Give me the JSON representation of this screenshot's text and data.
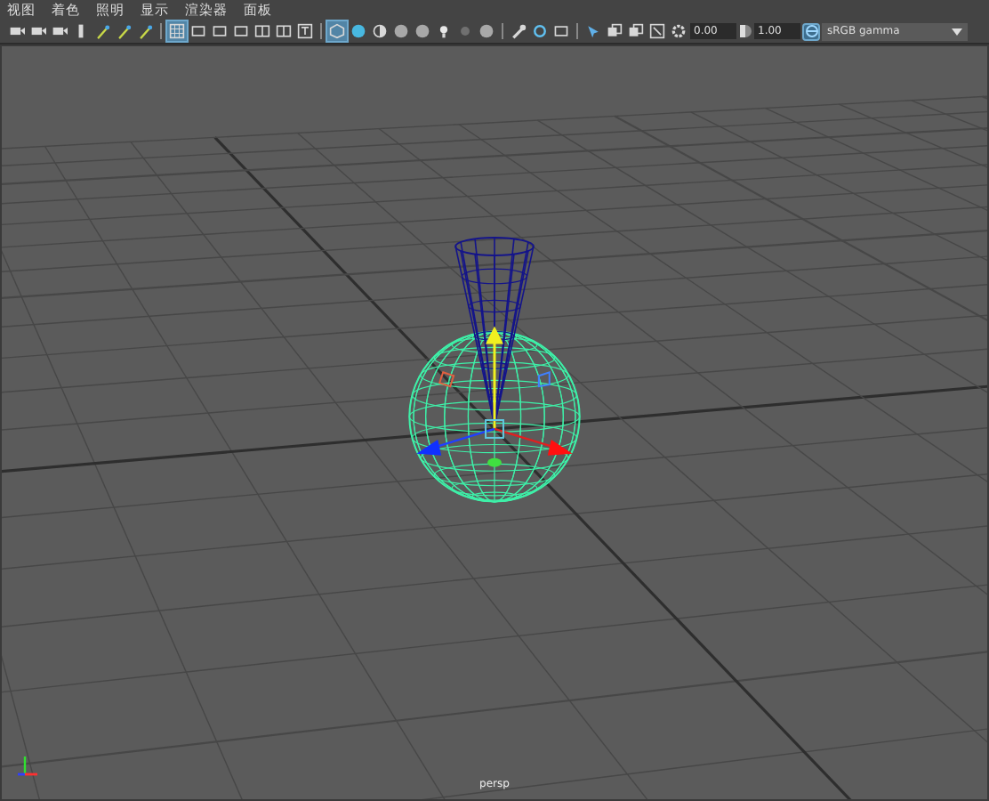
{
  "menu": [
    "视图",
    "着色",
    "照明",
    "显示",
    "渲染器",
    "面板"
  ],
  "toolbar_buttons": [
    {
      "on": false
    },
    {
      "on": false
    },
    {
      "on": false
    },
    {
      "on": false
    },
    {
      "on": false
    },
    {
      "on": false
    },
    {
      "on": false
    },
    {
      "on": true
    },
    {
      "on": false
    },
    {
      "on": false
    },
    {
      "on": false
    },
    {
      "on": false
    },
    {
      "on": false
    },
    {
      "on": false
    },
    {
      "on": true
    },
    {
      "on": false
    },
    {
      "on": false
    },
    {
      "on": false
    },
    {
      "on": false
    },
    {
      "on": false
    },
    {
      "on": false
    },
    {
      "on": false
    },
    {
      "on": false
    },
    {
      "on": false
    },
    {
      "on": false
    },
    {
      "on": false
    },
    {
      "on": false
    },
    {
      "on": false
    },
    {
      "on": false
    },
    {
      "on": false
    }
  ],
  "exposure": "0.00",
  "gamma": "1.00",
  "color_management_on": true,
  "view_transform": "sRGB gamma",
  "camera_label": "persp"
}
